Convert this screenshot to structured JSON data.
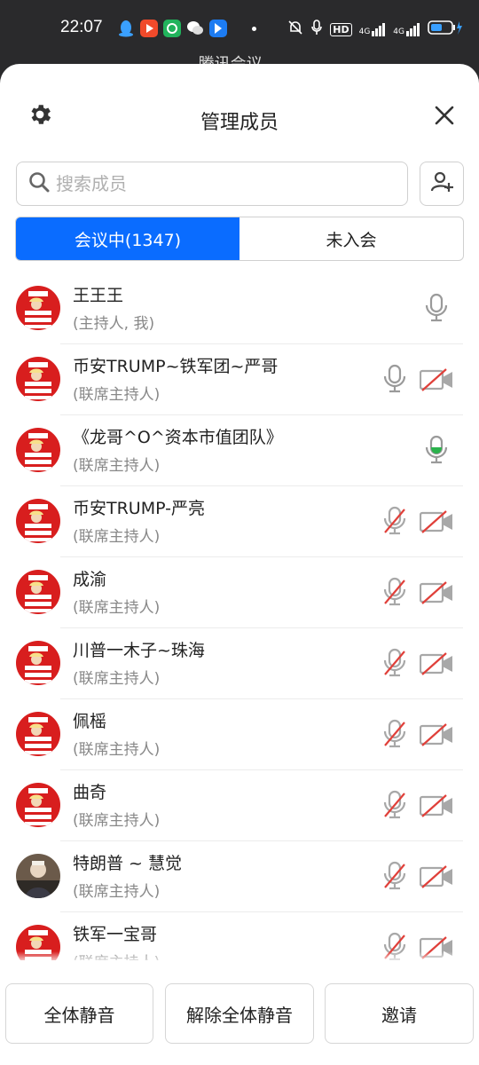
{
  "status_bar": {
    "time": "22:07",
    "app_icons": [
      "qq-icon",
      "video-icon",
      "music-icon",
      "wechat-icon",
      "meeting-app-icon"
    ],
    "right_icons": [
      "mute-bell-icon",
      "mic-status-icon",
      "hd-icon",
      "signal-4g-icon",
      "signal-4g-icon",
      "battery-charging-icon"
    ],
    "hd_text": "HD",
    "net1": "4G",
    "net2": "4G"
  },
  "background_title": "腾讯会议 ⌄",
  "header": {
    "title": "管理成员"
  },
  "search": {
    "placeholder": "搜索成员",
    "value": ""
  },
  "tabs": [
    {
      "label": "会议中(1347)",
      "active": true
    },
    {
      "label": "未入会",
      "active": false
    }
  ],
  "members": [
    {
      "name": "王王王",
      "role": "(主持人, 我)",
      "avatar": "trump",
      "mic": "on",
      "cam": "none"
    },
    {
      "name": "币安TRUMP~铁军团~严哥",
      "role": "(联席主持人)",
      "avatar": "trump",
      "mic": "on",
      "cam": "off"
    },
    {
      "name": "《龙哥^O^资本市值团队》",
      "role": "(联席主持人)",
      "avatar": "trump",
      "mic": "speaking",
      "cam": "none"
    },
    {
      "name": "币安TRUMP-严亮",
      "role": "(联席主持人)",
      "avatar": "trump",
      "mic": "off",
      "cam": "off"
    },
    {
      "name": "成渝",
      "role": "(联席主持人)",
      "avatar": "trump",
      "mic": "off",
      "cam": "off"
    },
    {
      "name": "川普一木子~珠海",
      "role": "(联席主持人)",
      "avatar": "trump",
      "mic": "off",
      "cam": "off"
    },
    {
      "name": "佩榣",
      "role": "(联席主持人)",
      "avatar": "trump",
      "mic": "off",
      "cam": "off"
    },
    {
      "name": "曲奇",
      "role": "(联席主持人)",
      "avatar": "trump",
      "mic": "off",
      "cam": "off"
    },
    {
      "name": "特朗普 ~ 慧觉",
      "role": "(联席主持人)",
      "avatar": "photo",
      "mic": "off",
      "cam": "off"
    },
    {
      "name": "铁军一宝哥",
      "role": "(联席主持人)",
      "avatar": "trump",
      "mic": "off",
      "cam": "off"
    }
  ],
  "footer": {
    "mute_all": "全体静音",
    "unmute_all": "解除全体静音",
    "invite": "邀请"
  },
  "colors": {
    "accent": "#0a6cff",
    "muted_red": "#e0403a",
    "icon_gray": "#9a9a9a",
    "speaking_green": "#2bb24c"
  }
}
